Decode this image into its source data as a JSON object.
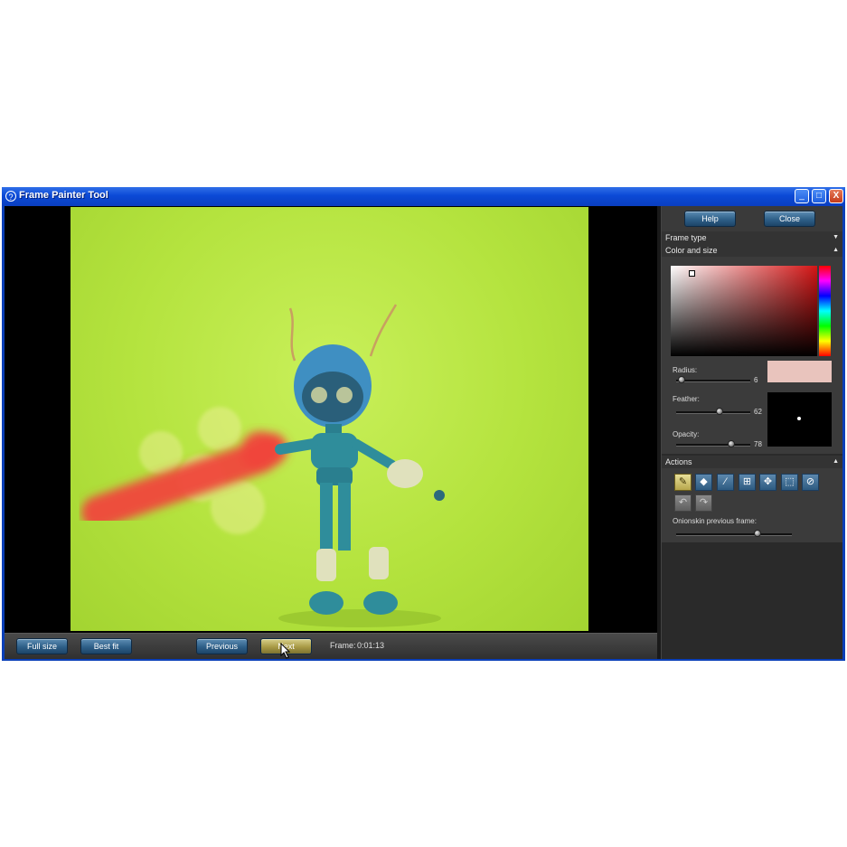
{
  "window": {
    "title": "Frame Painter Tool",
    "controls": {
      "minimize": "_",
      "maximize": "□",
      "close": "X"
    }
  },
  "bottom_bar": {
    "full_size": "Full size",
    "best_fit": "Best fit",
    "previous": "Previous",
    "next": "Next",
    "frame_label": "Frame:",
    "frame_value": "0:01:13"
  },
  "side_panel": {
    "help": "Help",
    "close": "Close",
    "frame_type": "Frame type",
    "color_and_size": "Color and size",
    "radius_label": "Radius:",
    "radius_value": "6",
    "feather_label": "Feather:",
    "feather_value": "62",
    "opacity_label": "Opacity:",
    "opacity_value": "78",
    "actions": "Actions",
    "onionskin_label": "Onionskin previous frame:",
    "brush_color": "#e9c4bd",
    "onionskin_level": 0.7
  },
  "icons": {
    "app": "app-logo-icon",
    "tools": [
      "brush-icon",
      "eraser-icon",
      "eyedropper-icon",
      "import-icon",
      "move-icon",
      "select-icon",
      "clear-icon",
      "undo-icon",
      "redo-icon"
    ]
  }
}
